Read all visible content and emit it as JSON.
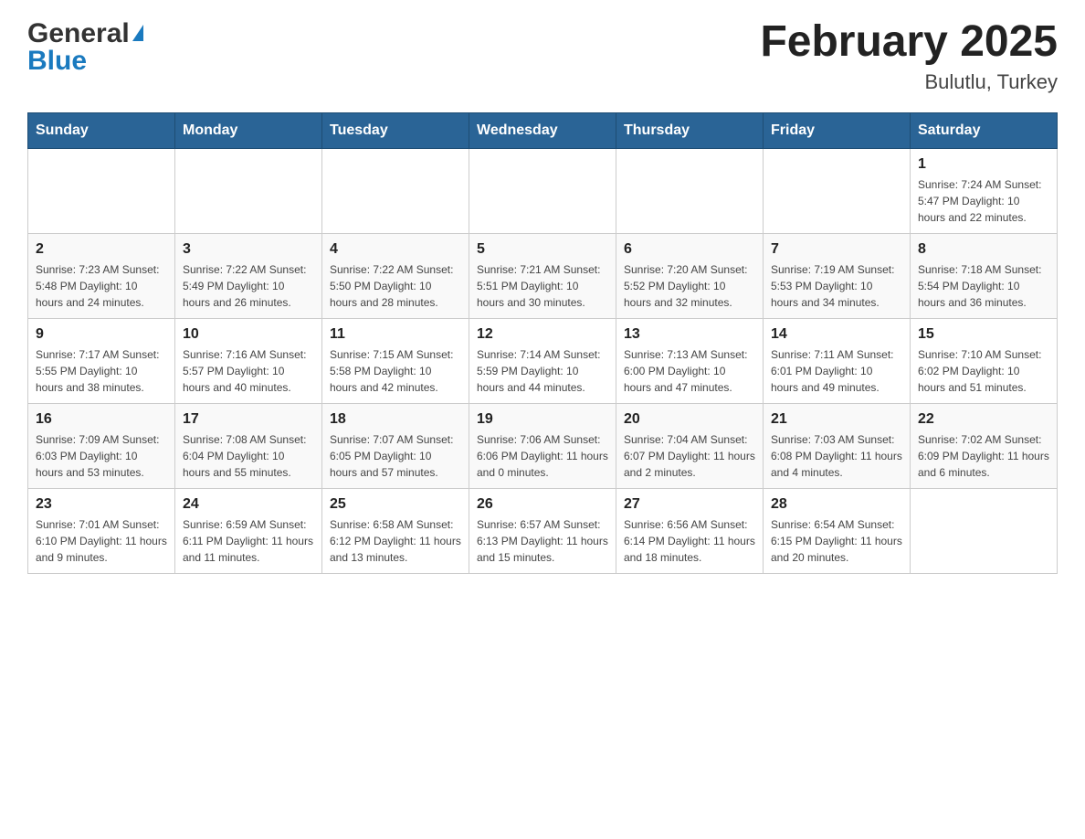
{
  "header": {
    "logo": {
      "general": "General",
      "blue": "Blue"
    },
    "title": "February 2025",
    "location": "Bulutlu, Turkey"
  },
  "days_of_week": [
    "Sunday",
    "Monday",
    "Tuesday",
    "Wednesday",
    "Thursday",
    "Friday",
    "Saturday"
  ],
  "weeks": [
    {
      "days": [
        {
          "num": "",
          "info": ""
        },
        {
          "num": "",
          "info": ""
        },
        {
          "num": "",
          "info": ""
        },
        {
          "num": "",
          "info": ""
        },
        {
          "num": "",
          "info": ""
        },
        {
          "num": "",
          "info": ""
        },
        {
          "num": "1",
          "info": "Sunrise: 7:24 AM\nSunset: 5:47 PM\nDaylight: 10 hours\nand 22 minutes."
        }
      ]
    },
    {
      "days": [
        {
          "num": "2",
          "info": "Sunrise: 7:23 AM\nSunset: 5:48 PM\nDaylight: 10 hours\nand 24 minutes."
        },
        {
          "num": "3",
          "info": "Sunrise: 7:22 AM\nSunset: 5:49 PM\nDaylight: 10 hours\nand 26 minutes."
        },
        {
          "num": "4",
          "info": "Sunrise: 7:22 AM\nSunset: 5:50 PM\nDaylight: 10 hours\nand 28 minutes."
        },
        {
          "num": "5",
          "info": "Sunrise: 7:21 AM\nSunset: 5:51 PM\nDaylight: 10 hours\nand 30 minutes."
        },
        {
          "num": "6",
          "info": "Sunrise: 7:20 AM\nSunset: 5:52 PM\nDaylight: 10 hours\nand 32 minutes."
        },
        {
          "num": "7",
          "info": "Sunrise: 7:19 AM\nSunset: 5:53 PM\nDaylight: 10 hours\nand 34 minutes."
        },
        {
          "num": "8",
          "info": "Sunrise: 7:18 AM\nSunset: 5:54 PM\nDaylight: 10 hours\nand 36 minutes."
        }
      ]
    },
    {
      "days": [
        {
          "num": "9",
          "info": "Sunrise: 7:17 AM\nSunset: 5:55 PM\nDaylight: 10 hours\nand 38 minutes."
        },
        {
          "num": "10",
          "info": "Sunrise: 7:16 AM\nSunset: 5:57 PM\nDaylight: 10 hours\nand 40 minutes."
        },
        {
          "num": "11",
          "info": "Sunrise: 7:15 AM\nSunset: 5:58 PM\nDaylight: 10 hours\nand 42 minutes."
        },
        {
          "num": "12",
          "info": "Sunrise: 7:14 AM\nSunset: 5:59 PM\nDaylight: 10 hours\nand 44 minutes."
        },
        {
          "num": "13",
          "info": "Sunrise: 7:13 AM\nSunset: 6:00 PM\nDaylight: 10 hours\nand 47 minutes."
        },
        {
          "num": "14",
          "info": "Sunrise: 7:11 AM\nSunset: 6:01 PM\nDaylight: 10 hours\nand 49 minutes."
        },
        {
          "num": "15",
          "info": "Sunrise: 7:10 AM\nSunset: 6:02 PM\nDaylight: 10 hours\nand 51 minutes."
        }
      ]
    },
    {
      "days": [
        {
          "num": "16",
          "info": "Sunrise: 7:09 AM\nSunset: 6:03 PM\nDaylight: 10 hours\nand 53 minutes."
        },
        {
          "num": "17",
          "info": "Sunrise: 7:08 AM\nSunset: 6:04 PM\nDaylight: 10 hours\nand 55 minutes."
        },
        {
          "num": "18",
          "info": "Sunrise: 7:07 AM\nSunset: 6:05 PM\nDaylight: 10 hours\nand 57 minutes."
        },
        {
          "num": "19",
          "info": "Sunrise: 7:06 AM\nSunset: 6:06 PM\nDaylight: 11 hours\nand 0 minutes."
        },
        {
          "num": "20",
          "info": "Sunrise: 7:04 AM\nSunset: 6:07 PM\nDaylight: 11 hours\nand 2 minutes."
        },
        {
          "num": "21",
          "info": "Sunrise: 7:03 AM\nSunset: 6:08 PM\nDaylight: 11 hours\nand 4 minutes."
        },
        {
          "num": "22",
          "info": "Sunrise: 7:02 AM\nSunset: 6:09 PM\nDaylight: 11 hours\nand 6 minutes."
        }
      ]
    },
    {
      "days": [
        {
          "num": "23",
          "info": "Sunrise: 7:01 AM\nSunset: 6:10 PM\nDaylight: 11 hours\nand 9 minutes."
        },
        {
          "num": "24",
          "info": "Sunrise: 6:59 AM\nSunset: 6:11 PM\nDaylight: 11 hours\nand 11 minutes."
        },
        {
          "num": "25",
          "info": "Sunrise: 6:58 AM\nSunset: 6:12 PM\nDaylight: 11 hours\nand 13 minutes."
        },
        {
          "num": "26",
          "info": "Sunrise: 6:57 AM\nSunset: 6:13 PM\nDaylight: 11 hours\nand 15 minutes."
        },
        {
          "num": "27",
          "info": "Sunrise: 6:56 AM\nSunset: 6:14 PM\nDaylight: 11 hours\nand 18 minutes."
        },
        {
          "num": "28",
          "info": "Sunrise: 6:54 AM\nSunset: 6:15 PM\nDaylight: 11 hours\nand 20 minutes."
        },
        {
          "num": "",
          "info": ""
        }
      ]
    }
  ]
}
